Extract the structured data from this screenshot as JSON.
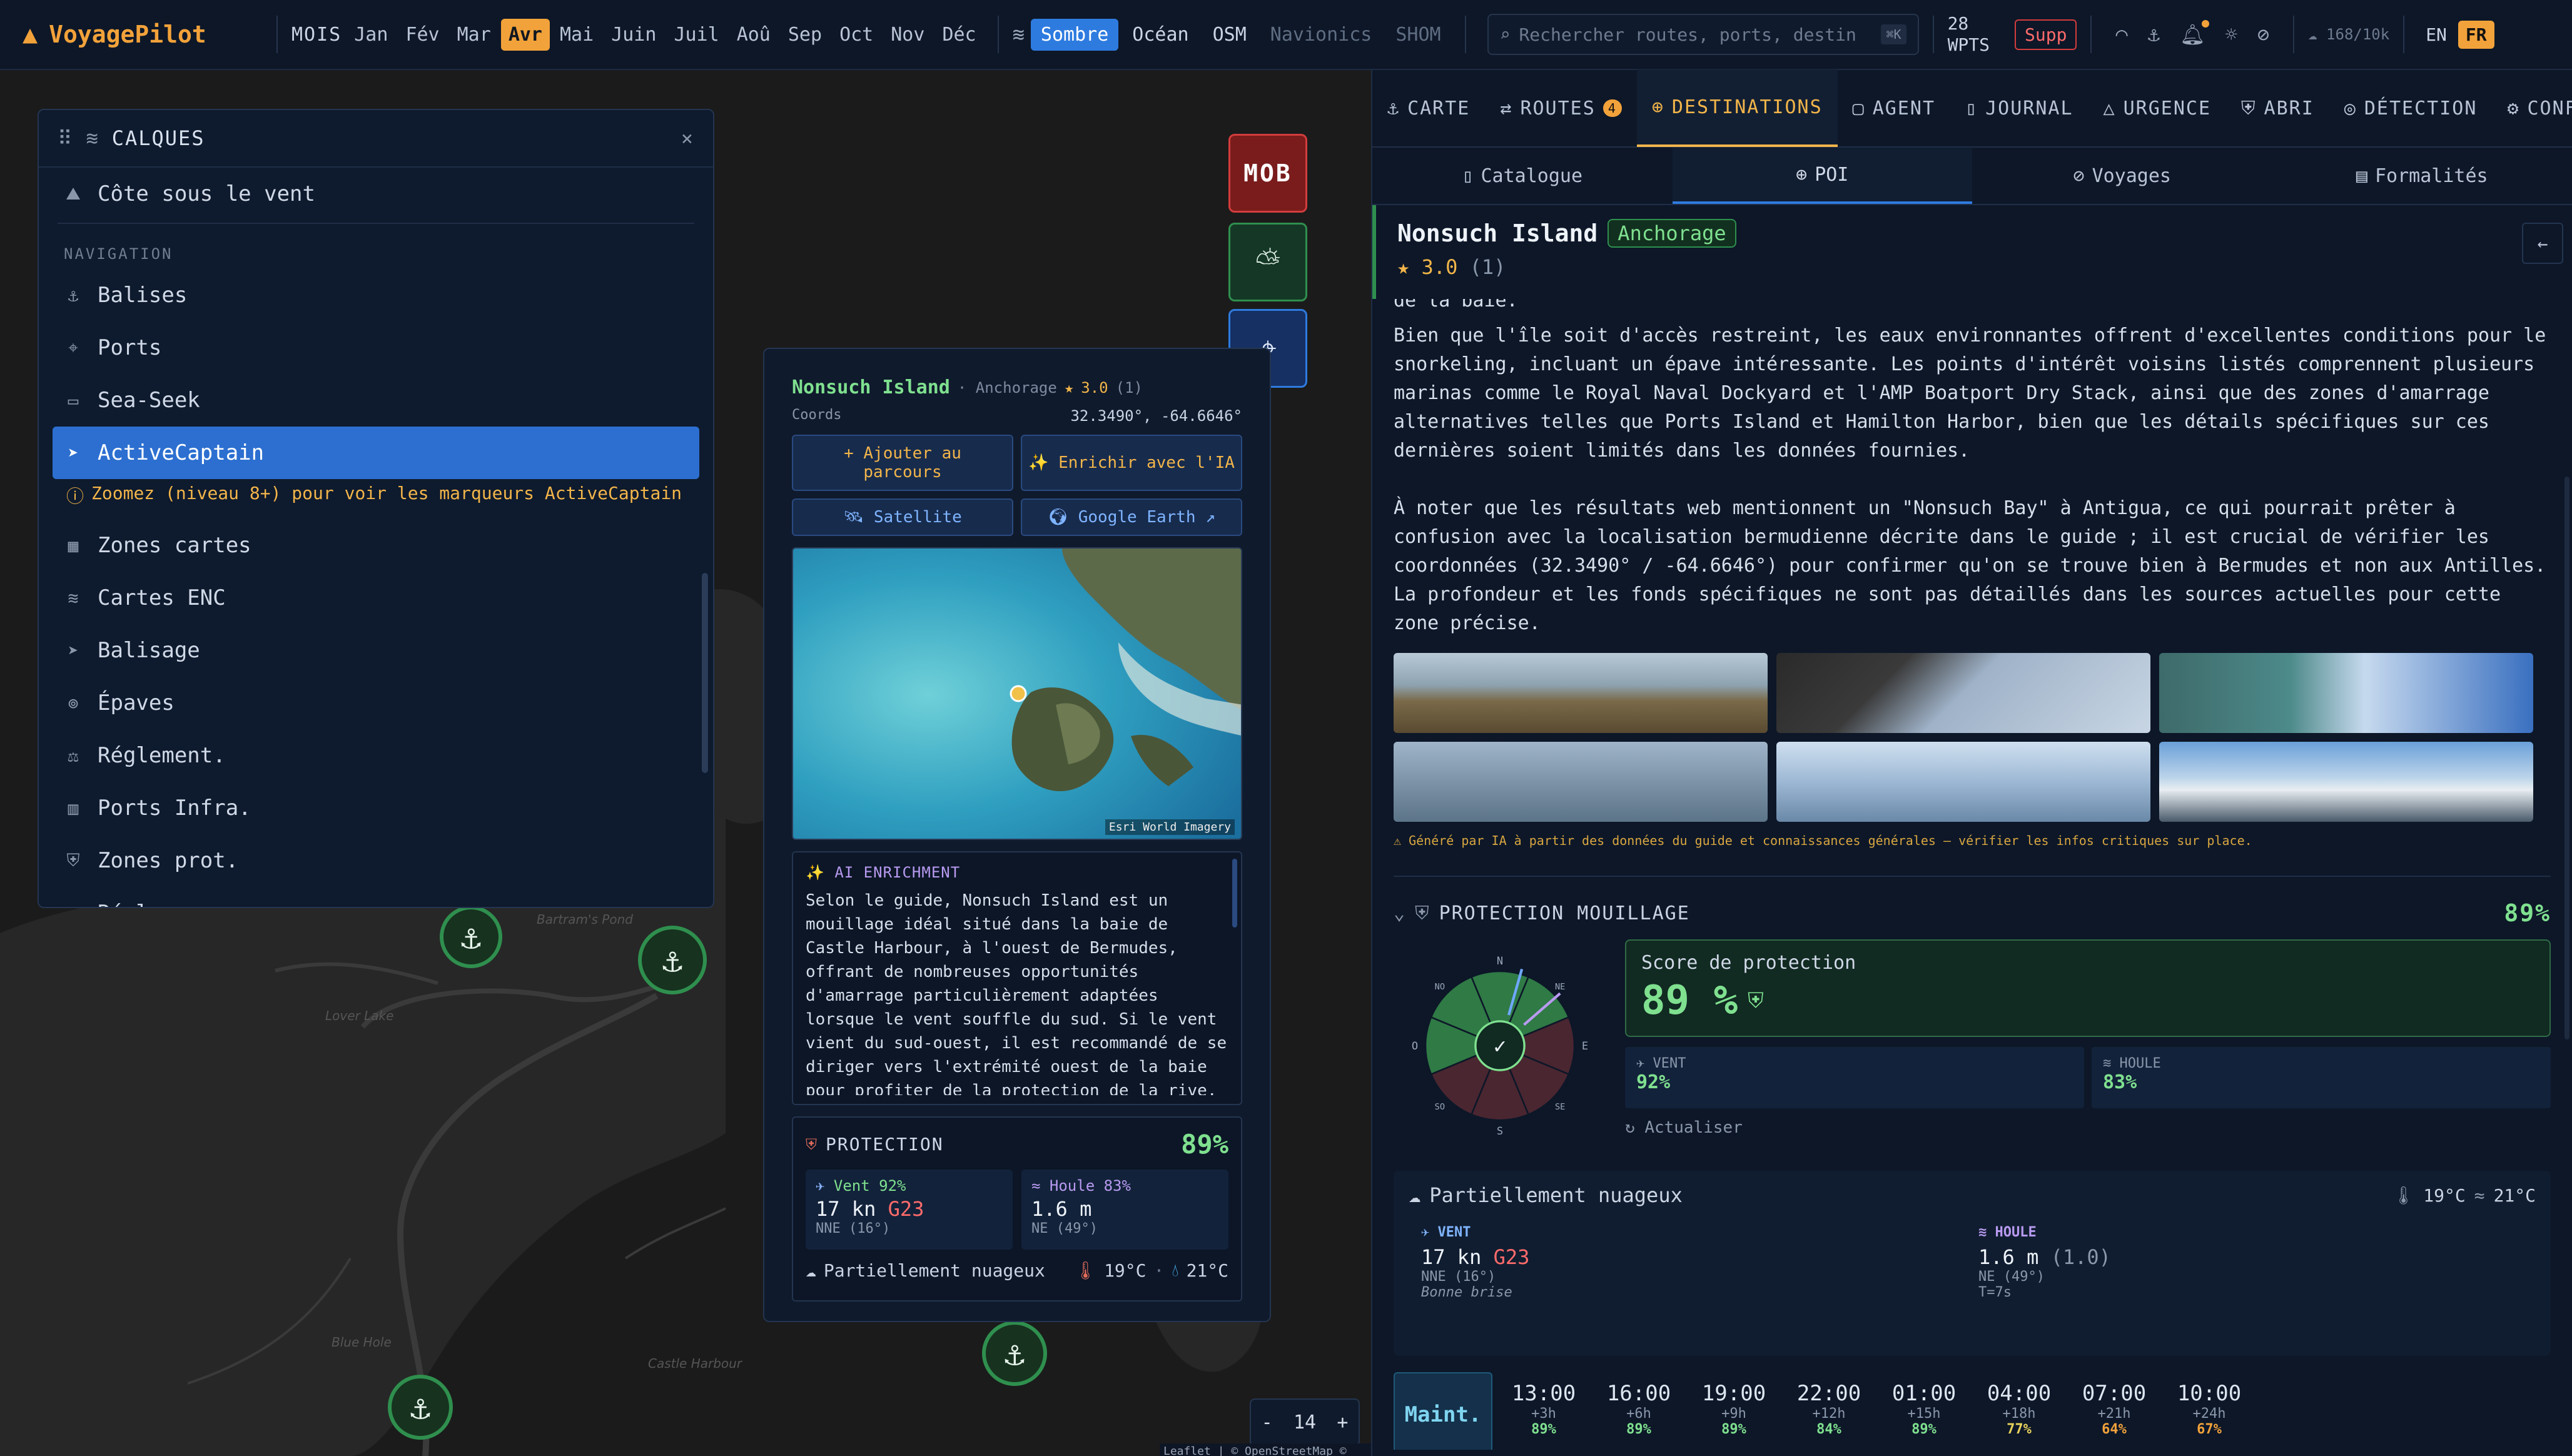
{
  "brand": {
    "name": "VoyagePilot",
    "icon": "sail-logo-icon",
    "color": "#f2a23a"
  },
  "months": {
    "label": "MOIS",
    "items": [
      "Jan",
      "Fév",
      "Mar",
      "Avr",
      "Mai",
      "Juin",
      "Juil",
      "Aoû",
      "Sep",
      "Oct",
      "Nov",
      "Déc"
    ],
    "active": "Avr"
  },
  "basemaps": {
    "items": [
      "Sombre",
      "Océan",
      "OSM",
      "Navionics",
      "SHOM"
    ],
    "active": "Sombre",
    "disabled": [
      "Navionics",
      "SHOM"
    ]
  },
  "search": {
    "placeholder": "Rechercher routes, ports, destin",
    "shortcut": "⌘K"
  },
  "waypoints": {
    "count": "28",
    "label": "WPTS"
  },
  "supp_label": "Supp",
  "quota": "168/10k",
  "languages": {
    "items": [
      "EN",
      "FR"
    ],
    "active": "FR"
  },
  "layers_panel": {
    "title": "CALQUES",
    "items_top": [
      {
        "label": "Côte sous le vent",
        "icon": "mountain-icon"
      }
    ],
    "section_navigation": "NAVIGATION",
    "items": [
      {
        "label": "Balises",
        "icon": "anchor-icon"
      },
      {
        "label": "Ports",
        "icon": "pin-icon"
      },
      {
        "label": "Sea-Seek",
        "icon": "book-icon"
      },
      {
        "label": "ActiveCaptain",
        "icon": "navigation-arrow-icon",
        "active": true
      }
    ],
    "warning": "Zoomez (niveau 8+) pour voir les marqueurs ActiveCaptain",
    "items_after": [
      {
        "label": "Zones cartes",
        "icon": "map-icon"
      },
      {
        "label": "Cartes ENC",
        "icon": "layers-icon"
      },
      {
        "label": "Balisage",
        "icon": "navigation-arrow-icon"
      },
      {
        "label": "Épaves",
        "icon": "wreck-icon"
      },
      {
        "label": "Réglement.",
        "icon": "scale-icon"
      },
      {
        "label": "Ports Infra.",
        "icon": "building-icon"
      },
      {
        "label": "Zones prot.",
        "icon": "shield-icon"
      },
      {
        "label": "Réglem. nav.",
        "icon": "document-icon"
      }
    ]
  },
  "map": {
    "labels": [
      "Bartram's Pond",
      "Lover Lake",
      "Blue Hole",
      "Castle Harbour"
    ],
    "zoom": "14",
    "attribution": "Leaflet | © OpenStreetMap © CARTO",
    "mob_label": "MOB"
  },
  "popup": {
    "name": "Nonsuch Island",
    "type": "Anchorage",
    "rating": "3.0",
    "rating_count": "(1)",
    "coords_label": "Coords",
    "coords": "32.3490°, -64.6646°",
    "btn_add": "+ Ajouter au parcours",
    "btn_ai": "✨ Enrichir avec l'IA",
    "btn_satellite": "Satellite",
    "btn_earth": "Google Earth ↗",
    "imagery_credit": "Esri World Imagery",
    "ai_title": "✨ AI ENRICHMENT",
    "ai_text": "Selon le guide, Nonsuch Island est un mouillage idéal situé dans la baie de Castle Harbour, à l'ouest de Bermudes, offrant de nombreuses opportunités d'amarrage particulièrement adaptées lorsque le vent souffle du sud. Si le vent vient du sud-ouest, il est recommandé de se diriger vers l'extrémité ouest de la baie pour profiter de la protection de la rive, tandis qu'un vent",
    "protection_label": "PROTECTION",
    "protection_value": "89%",
    "wind_label": "Vent",
    "wind_pct": "92%",
    "wind_speed": "17 kn",
    "wind_gust": "G23",
    "wind_dir": "NNE (16°)",
    "swell_label": "Houle",
    "swell_pct": "83%",
    "swell_height": "1.6 m",
    "swell_dir": "NE (49°)",
    "weather": "Partiellement nuageux",
    "temp_air": "19°C",
    "temp_water": "21°C"
  },
  "right_panel": {
    "tabs": [
      {
        "label": "CARTE",
        "icon": "anchor-icon"
      },
      {
        "label": "ROUTES",
        "icon": "route-icon",
        "badge": "4"
      },
      {
        "label": "DESTINATIONS",
        "icon": "globe-icon",
        "active": true
      },
      {
        "label": "AGENT",
        "icon": "chat-icon"
      },
      {
        "label": "JOURNAL",
        "icon": "book-icon"
      },
      {
        "label": "URGENCE",
        "icon": "warning-icon"
      },
      {
        "label": "ABRI",
        "icon": "shield-icon"
      },
      {
        "label": "DÉTECTION",
        "icon": "radar-icon"
      },
      {
        "label": "CONF",
        "icon": "gear-icon"
      }
    ],
    "subtabs": [
      {
        "label": "Catalogue",
        "icon": "book-icon"
      },
      {
        "label": "POI",
        "icon": "globe-icon",
        "active": true
      },
      {
        "label": "Voyages",
        "icon": "compass-icon"
      },
      {
        "label": "Formalités",
        "icon": "document-icon"
      }
    ],
    "poi_name": "Nonsuch Island",
    "poi_type": "Anchorage",
    "rating": "★ 3.0",
    "rating_count": "(1)",
    "text_cut": "de la baie.",
    "para1": "Bien que l'île soit d'accès restreint, les eaux environnantes offrent d'excellentes conditions pour le snorkeling, incluant un épave intéressante. Les points d'intérêt voisins listés comprennent plusieurs marinas comme le Royal Naval Dockyard et l'AMP Boatport Dry Stack, ainsi que des zones d'amarrage alternatives telles que Ports Island et Hamilton Harbor, bien que les détails spécifiques sur ces dernières soient limités dans les données fournies.",
    "para2": "À noter que les résultats web mentionnent un \"Nonsuch Bay\" à Antigua, ce qui pourrait prêter à confusion avec la localisation bermudienne décrite dans le guide ; il est crucial de vérifier les coordonnées (32.3490° / -64.6646°) pour confirmer qu'on se trouve bien à Bermudes et non aux Antilles. La profondeur et les fonds spécifiques ne sont pas détaillés dans les sources actuelles pour cette zone précise.",
    "ai_disclaimer": "⚠ Généré par IA à partir des données du guide et connaissances générales — vérifier les infos critiques sur place.",
    "protection": {
      "title": "PROTECTION MOUILLAGE",
      "value": "89%",
      "score_label": "Score de protection",
      "score": "89 %",
      "wind_label": "VENT",
      "wind_value": "92%",
      "swell_label": "HOULE",
      "swell_value": "83%",
      "refresh": "Actualiser",
      "compass": [
        "N",
        "NE",
        "E",
        "SE",
        "S",
        "SO",
        "O",
        "NO"
      ]
    },
    "weather": {
      "title": "Partiellement nuageux",
      "temp_air": "19°C",
      "temp_water": "21°C",
      "wind_label": "VENT",
      "wind_speed": "17 kn",
      "wind_gust": "G23",
      "wind_dir": "NNE (16°)",
      "wind_desc": "Bonne brise",
      "swell_label": "HOULE",
      "swell_height": "1.6 m",
      "swell_max": "(1.0)",
      "swell_dir": "NE (49°)",
      "swell_period": "T=7s"
    },
    "forecast": {
      "now_label": "Maint.",
      "slots": [
        {
          "time": "13:00",
          "delta": "+3h",
          "pct": "89%",
          "color": "#7fe08f"
        },
        {
          "time": "16:00",
          "delta": "+6h",
          "pct": "89%",
          "color": "#7fe08f"
        },
        {
          "time": "19:00",
          "delta": "+9h",
          "pct": "89%",
          "color": "#7fe08f"
        },
        {
          "time": "22:00",
          "delta": "+12h",
          "pct": "84%",
          "color": "#7fe08f"
        },
        {
          "time": "01:00",
          "delta": "+15h",
          "pct": "89%",
          "color": "#7fe08f"
        },
        {
          "time": "04:00",
          "delta": "+18h",
          "pct": "77%",
          "color": "#e8d25a"
        },
        {
          "time": "07:00",
          "delta": "+21h",
          "pct": "64%",
          "color": "#f2a23a"
        },
        {
          "time": "10:00",
          "delta": "+24h",
          "pct": "67%",
          "color": "#f2a23a"
        }
      ]
    }
  },
  "colors": {
    "accent": "#f2a23a",
    "good": "#7fe08f",
    "active_blue": "#2e7be0",
    "danger": "#d33c3c"
  }
}
